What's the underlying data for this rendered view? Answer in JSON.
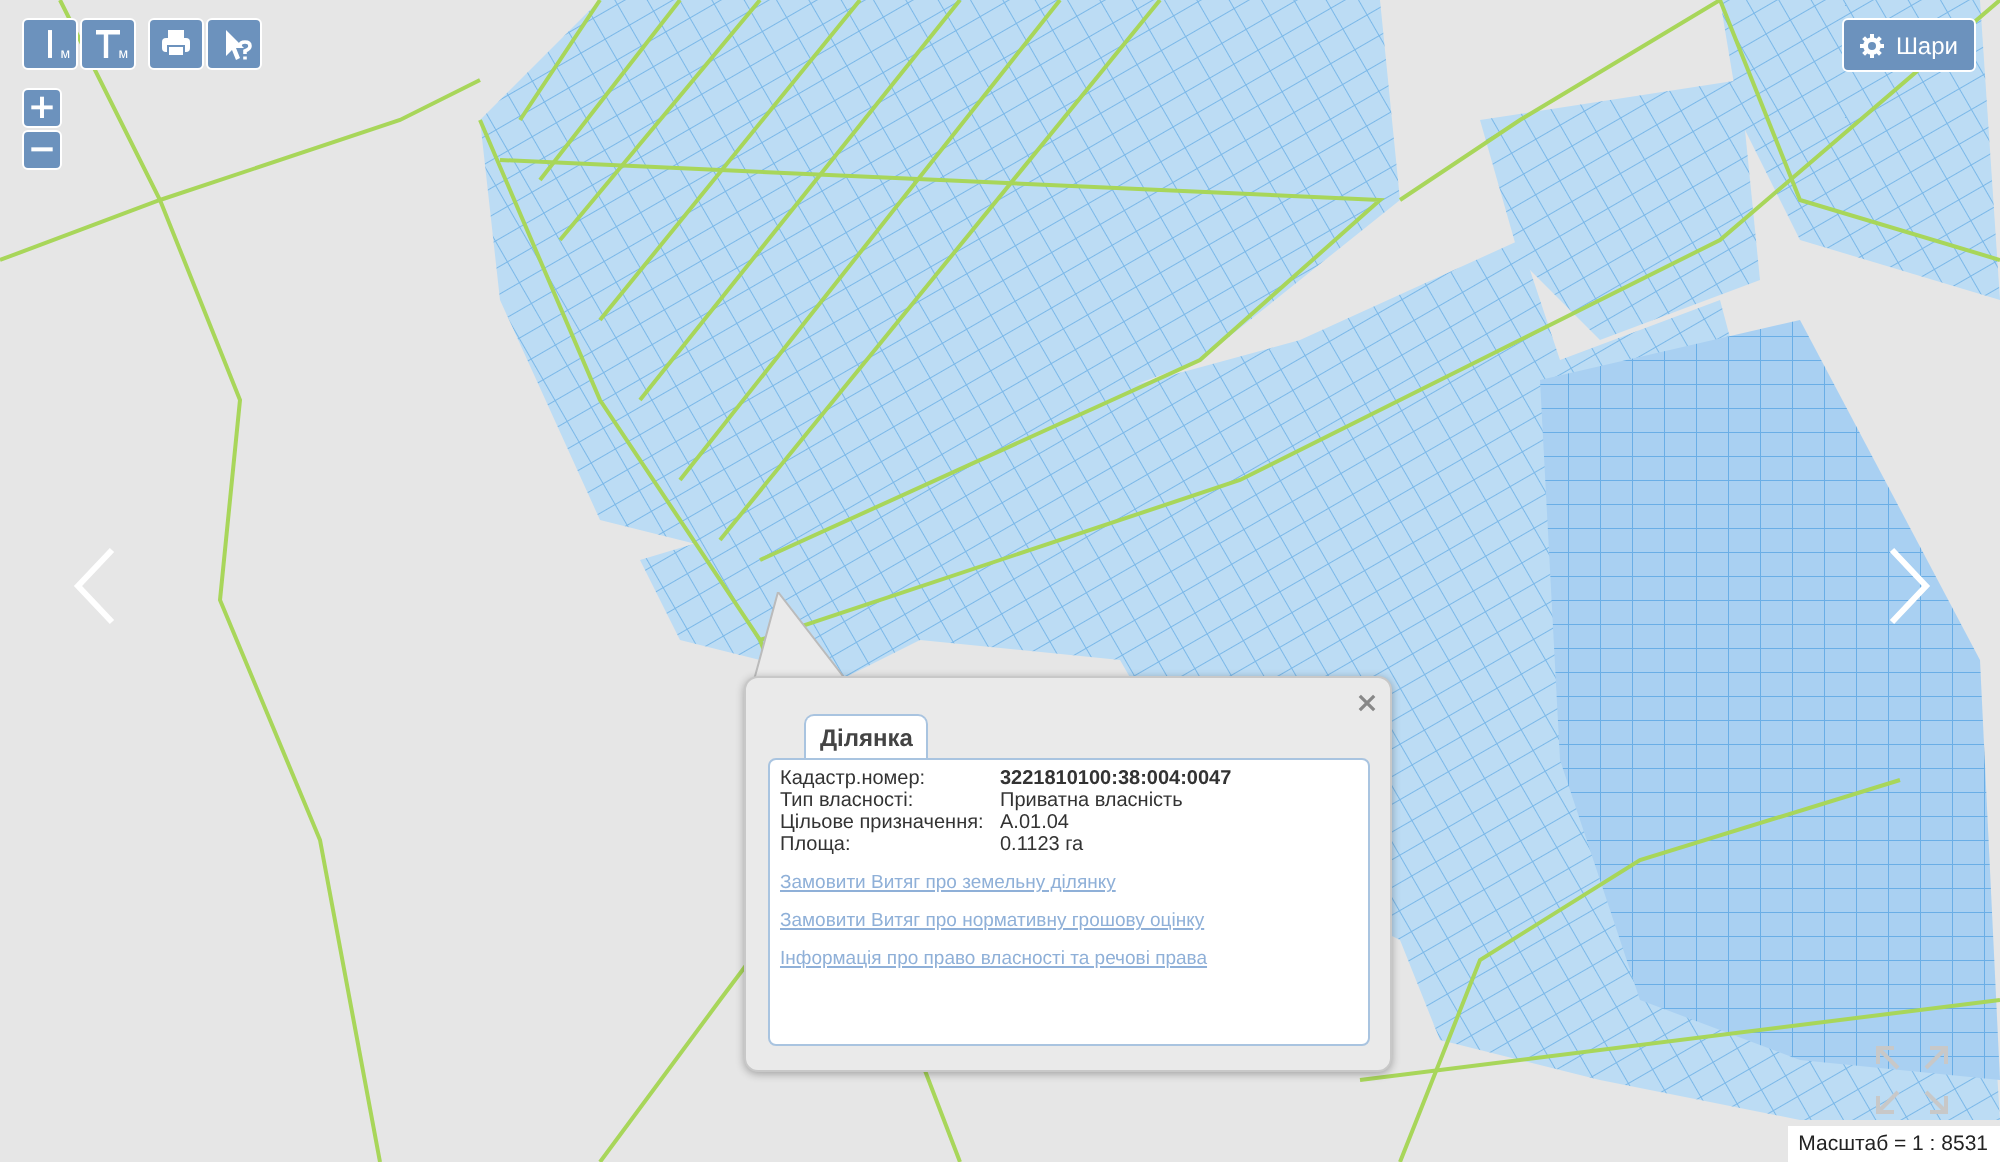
{
  "toolbar": {
    "measure_tools": [
      {
        "kind": "line",
        "sub": "м"
      },
      {
        "kind": "angle",
        "sub": "м"
      }
    ],
    "tools": [
      {
        "kind": "print"
      },
      {
        "kind": "identify"
      }
    ]
  },
  "zoom": {
    "in": "+",
    "out": "−"
  },
  "layers_button": {
    "label": "Шари"
  },
  "popup": {
    "tabs": [
      {
        "label": "Ділянка",
        "selected": true
      }
    ],
    "fields": [
      {
        "label": "Кадастр.номер:",
        "value": "3221810100:38:004:0047",
        "bold": true
      },
      {
        "label": "Тип власності:",
        "value": "Приватна власність",
        "bold": false
      },
      {
        "label": "Цільове призначення:",
        "value": "А.01.04",
        "bold": false
      },
      {
        "label": "Площа:",
        "value": "0.1123 га",
        "bold": false
      }
    ],
    "links": [
      "Замовити Витяг про земельну ділянку",
      "Замовити Витяг про нормативну грошову оцінку",
      "Інформація про право власності та речові права"
    ]
  },
  "scale": "Масштаб = 1 : 8531"
}
